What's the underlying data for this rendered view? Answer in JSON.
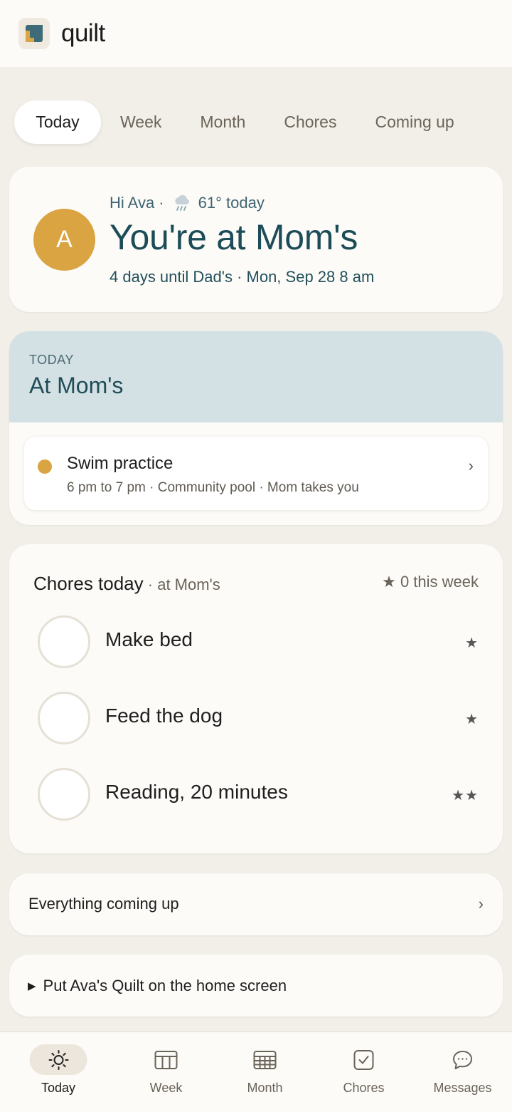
{
  "app": {
    "name": "quilt"
  },
  "tabs": [
    {
      "label": "Today",
      "active": true
    },
    {
      "label": "Week"
    },
    {
      "label": "Month"
    },
    {
      "label": "Chores"
    },
    {
      "label": "Coming up"
    }
  ],
  "hero": {
    "avatar_initial": "A",
    "greeting": "Hi Ava ·",
    "weather_icon": "rain-cloud-icon",
    "weather": "61° today",
    "title": "You're at Mom's",
    "subtitle": "4 days until Dad's · Mon, Sep 28 8 am"
  },
  "today": {
    "eyebrow": "TODAY",
    "title": "At Mom's",
    "events": [
      {
        "title": "Swim practice",
        "meta": "6 pm to 7 pm · Community pool · Mom takes you",
        "color": "#d9a441"
      }
    ]
  },
  "chores": {
    "title": "Chores today",
    "subtitle": " · at Mom's",
    "week_count": "★ 0 this week",
    "items": [
      {
        "label": "Make bed",
        "stars": "★"
      },
      {
        "label": "Feed the dog",
        "stars": "★"
      },
      {
        "label": "Reading, 20 minutes",
        "stars": "★★"
      }
    ]
  },
  "coming_up": {
    "label": "Everything coming up"
  },
  "install": {
    "label": "Put Ava's Quilt on the home screen",
    "marker": "▶"
  },
  "nav": [
    {
      "label": "Today",
      "icon": "sun-icon",
      "active": true
    },
    {
      "label": "Week",
      "icon": "week-calendar-icon"
    },
    {
      "label": "Month",
      "icon": "month-calendar-icon"
    },
    {
      "label": "Chores",
      "icon": "checkbox-icon"
    },
    {
      "label": "Messages",
      "icon": "chat-bubble-icon"
    }
  ],
  "colors": {
    "accent": "#d9a441",
    "teal": "#1c4c57",
    "background": "#f2efe9"
  }
}
